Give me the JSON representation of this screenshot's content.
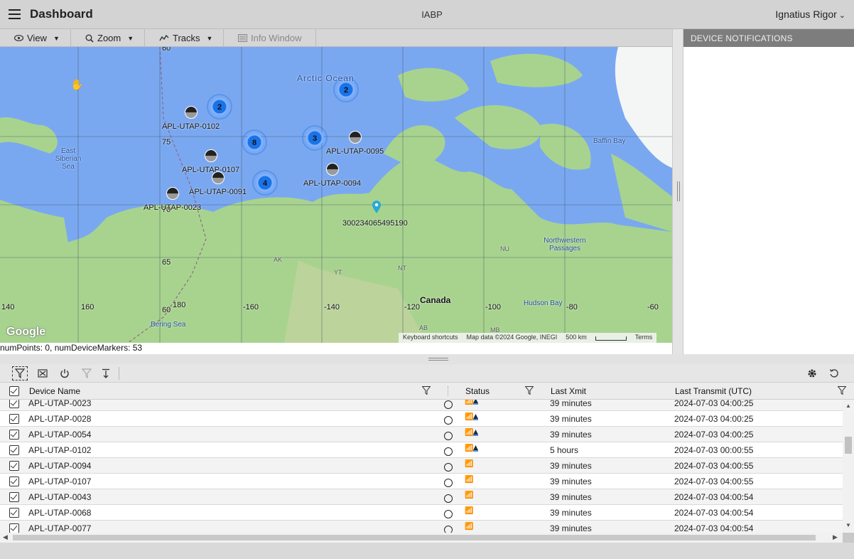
{
  "header": {
    "title": "Dashboard",
    "center": "IABP",
    "user": "Ignatius Rigor"
  },
  "toolbar": {
    "view": "View",
    "zoom": "Zoom",
    "tracks": "Tracks",
    "info": "Info Window"
  },
  "map": {
    "ocean_label": "Arctic Ocean",
    "places": [
      "East Siberian Sea",
      "Baffin Bay",
      "Northwestern Passages",
      "Hudson Bay",
      "Bering Sea",
      "Canada",
      "AK",
      "YT",
      "NT",
      "NU",
      "AB",
      "MB"
    ],
    "lat_labels": [
      "60",
      "75",
      "70",
      "65",
      "60"
    ],
    "lon_labels": [
      "140",
      "160",
      "180",
      "-160",
      "-140",
      "-120",
      "-100",
      "-80",
      "-60"
    ],
    "clusters": [
      "2",
      "2",
      "8",
      "3",
      "4"
    ],
    "devices": [
      "APL-UTAP-0102",
      "APL-UTAP-0095",
      "APL-UTAP-0107",
      "APL-UTAP-0094",
      "APL-UTAP-0091",
      "APL-UTAP-0023",
      "300234065495190"
    ],
    "footer": {
      "brand": "Google",
      "shortcuts": "Keyboard shortcuts",
      "mapdata": "Map data ©2024 Google, INEGI",
      "scale": "500 km",
      "terms": "Terms"
    }
  },
  "status_line": "numPoints: 0, numDeviceMarkers: 53",
  "notifications": {
    "title": "DEVICE NOTIFICATIONS"
  },
  "grid": {
    "columns": {
      "name": "Device Name",
      "status": "Status",
      "xmit": "Last Xmit",
      "utc": "Last Transmit (UTC)"
    },
    "rows": [
      {
        "name": "APL-UTAP-0023",
        "xmit": "39 minutes",
        "utc": "2024-07-03 04:00:25",
        "drop": true
      },
      {
        "name": "APL-UTAP-0028",
        "xmit": "39 minutes",
        "utc": "2024-07-03 04:00:25",
        "drop": true
      },
      {
        "name": "APL-UTAP-0054",
        "xmit": "39 minutes",
        "utc": "2024-07-03 04:00:25",
        "drop": true
      },
      {
        "name": "APL-UTAP-0102",
        "xmit": "5 hours",
        "utc": "2024-07-03 00:00:55",
        "drop": true
      },
      {
        "name": "APL-UTAP-0094",
        "xmit": "39 minutes",
        "utc": "2024-07-03 04:00:55",
        "drop": false
      },
      {
        "name": "APL-UTAP-0107",
        "xmit": "39 minutes",
        "utc": "2024-07-03 04:00:55",
        "drop": false
      },
      {
        "name": "APL-UTAP-0043",
        "xmit": "39 minutes",
        "utc": "2024-07-03 04:00:54",
        "drop": false
      },
      {
        "name": "APL-UTAP-0068",
        "xmit": "39 minutes",
        "utc": "2024-07-03 04:00:54",
        "drop": false
      },
      {
        "name": "APL-UTAP-0077",
        "xmit": "39 minutes",
        "utc": "2024-07-03 04:00:54",
        "drop": false
      }
    ]
  }
}
